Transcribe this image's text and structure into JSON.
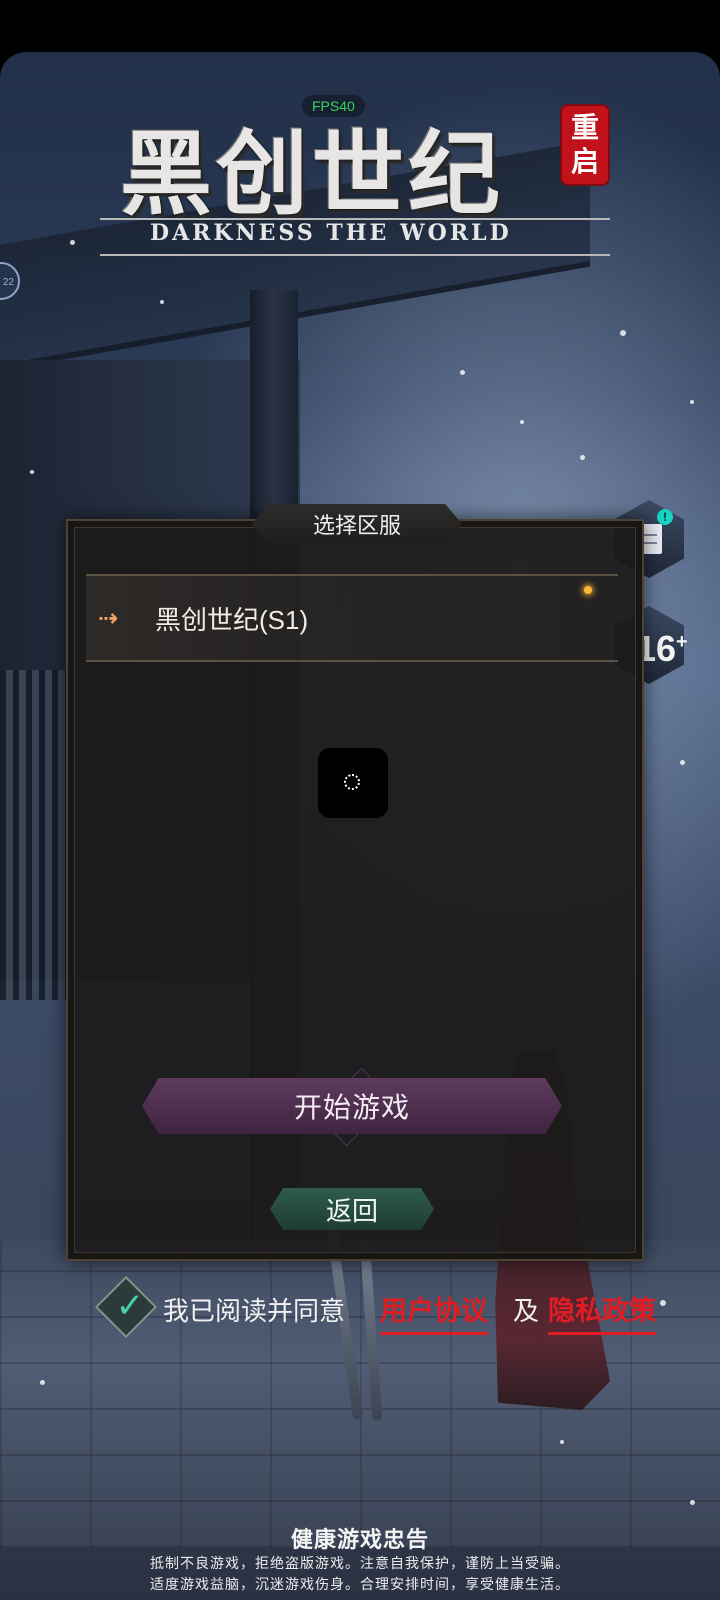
{
  "overlay": {
    "fps": "FPS40"
  },
  "logo": {
    "title": "黑创世纪",
    "tag_line1": "重",
    "tag_line2": "启",
    "subtitle": "DARKNESS THE WORLD"
  },
  "side_bubble": {
    "text": "22"
  },
  "right_icons": {
    "notice_badge": "!",
    "age_rating": "16",
    "age_plus": "+"
  },
  "server_panel": {
    "title": "选择区服",
    "servers": [
      {
        "name": "黑创世纪(S1)",
        "status_color": "#ffb733"
      }
    ],
    "start_label": "开始游戏",
    "back_label": "返回"
  },
  "agreement": {
    "checked": true,
    "text": "我已阅读并同意",
    "user_link": "用户协议",
    "and": "及",
    "privacy_link": "隐私政策",
    "link_color": "#e11c22"
  },
  "health": {
    "title": "健康游戏忠告",
    "line1": "抵制不良游戏，拒绝盗版游戏。注意自我保护，谨防上当受骗。",
    "line2": "适度游戏益脑，沉迷游戏伤身。合理安排时间，享受健康生活。"
  }
}
